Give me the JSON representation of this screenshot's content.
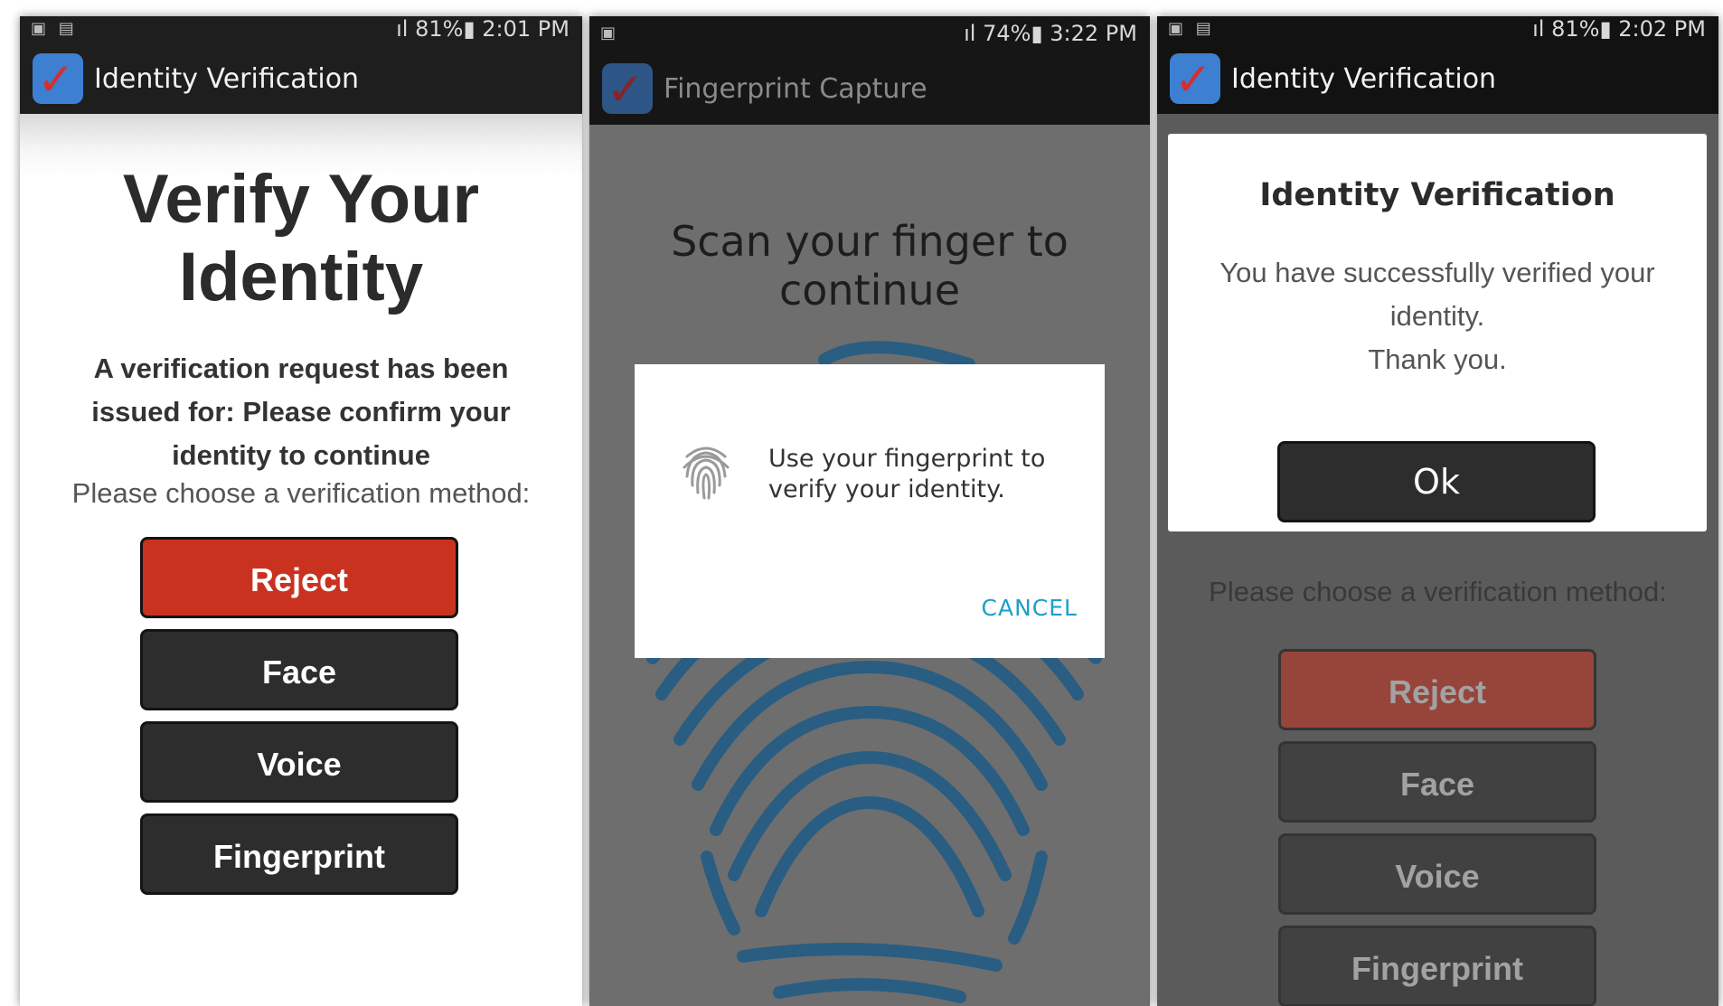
{
  "screen1": {
    "status": {
      "left_icons": "▣ ▤",
      "right": "ıl 81%▮ 2:01 PM"
    },
    "appbar": {
      "title": "Identity Verification"
    },
    "heading": "Verify Your Identity",
    "subtext": "A verification request has been issued for: Please confirm your identity to continue",
    "choose_label": "Please choose a verification method:",
    "buttons": {
      "reject": "Reject",
      "face": "Face",
      "voice": "Voice",
      "fingerprint": "Fingerprint"
    },
    "colors": {
      "reject": "#c9321f",
      "dark_button": "#2d2d2d",
      "appbar": "#1e1e1e"
    }
  },
  "screen2": {
    "status": {
      "left_icons": "▣",
      "right": "ıl 74%▮ 3:22 PM"
    },
    "appbar": {
      "title": "Fingerprint Capture"
    },
    "heading": "Scan your finger to continue",
    "dialog": {
      "message": "Use your fingerprint to verify your identity.",
      "cancel": "CANCEL",
      "icon": "fingerprint-icon"
    },
    "colors": {
      "fingerprint": "#1f5b86",
      "cancel": "#1aa0c8"
    }
  },
  "screen3": {
    "status": {
      "left_icons": "▣ ▤",
      "right": "ıl 81%▮ 2:02 PM"
    },
    "appbar": {
      "title": "Identity Verification"
    },
    "dialog": {
      "title": "Identity Verification",
      "message_line1": "You have successfully verified your identity.",
      "message_line2": "Thank you.",
      "ok": "Ok"
    },
    "choose_label": "Please choose a verification method:",
    "buttons": {
      "reject": "Reject",
      "face": "Face",
      "voice": "Voice",
      "fingerprint": "Fingerprint"
    }
  }
}
